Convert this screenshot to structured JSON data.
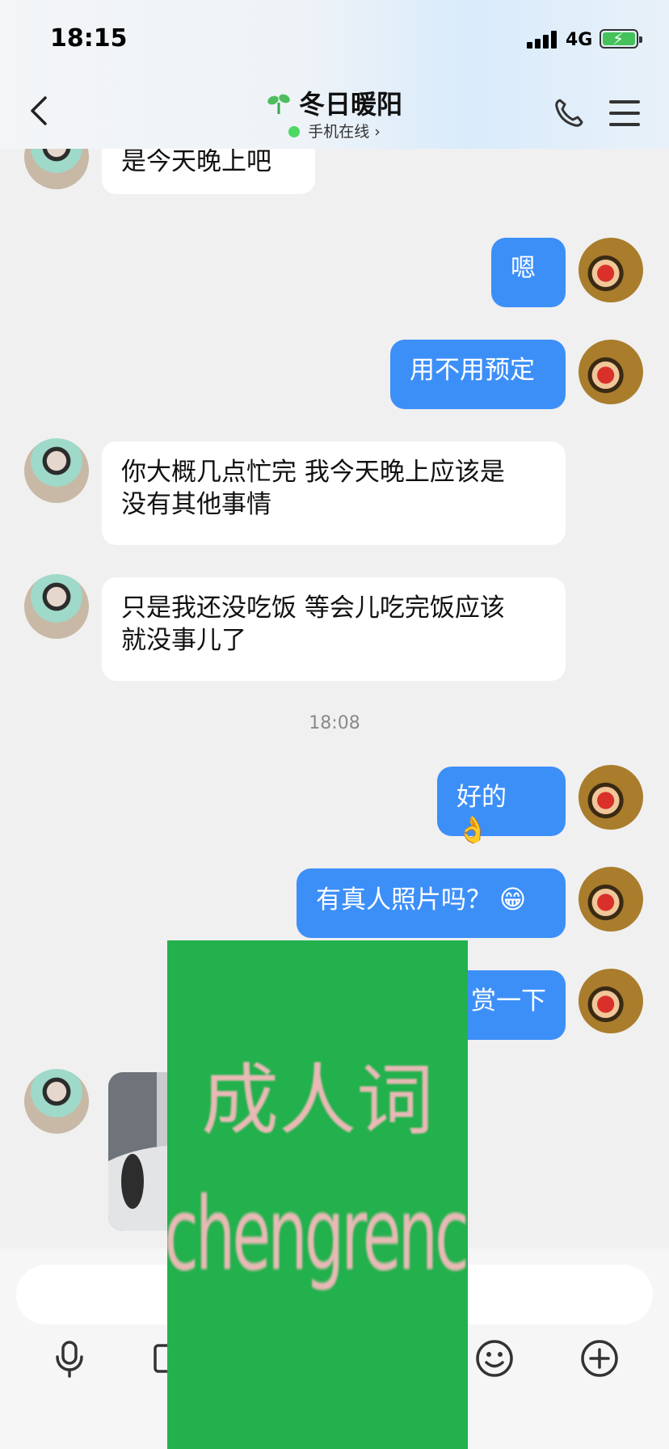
{
  "status_bar": {
    "time": "18:15",
    "network": "4G"
  },
  "header": {
    "title": "冬日暖阳",
    "subtitle": "手机在线",
    "subtitle_chevron": "›"
  },
  "messages": [
    {
      "side": "in",
      "text": "是今天晚上吧"
    },
    {
      "side": "out",
      "text": "嗯"
    },
    {
      "side": "out",
      "text": "用不用预定"
    },
    {
      "side": "in",
      "text_line1": "你大概几点忙完 我今天晚上应该是",
      "text_line2": "没有其他事情"
    },
    {
      "side": "in",
      "text_line1": "只是我还没吃饭 等会儿吃完饭应该",
      "text_line2": "就没事儿了"
    },
    {
      "timestamp": "18:08"
    },
    {
      "side": "out",
      "text": "好的",
      "emoji": "👌"
    },
    {
      "side": "out",
      "text": "有真人照片吗？",
      "emoji": "😁"
    },
    {
      "side": "out",
      "text": "赏一下"
    },
    {
      "side": "in",
      "type": "photo"
    }
  ],
  "watermark": {
    "line1": "成人词",
    "line2": "chengrenci.com"
  },
  "toolbar": {
    "icons": [
      "microphone-icon",
      "image-icon",
      "emoji-icon",
      "add-icon"
    ]
  },
  "colors": {
    "outgoing_bubble": "#3d8ff8",
    "incoming_bubble": "#ffffff",
    "online_dot": "#4cd964",
    "watermark_bg": "#22b14c"
  }
}
